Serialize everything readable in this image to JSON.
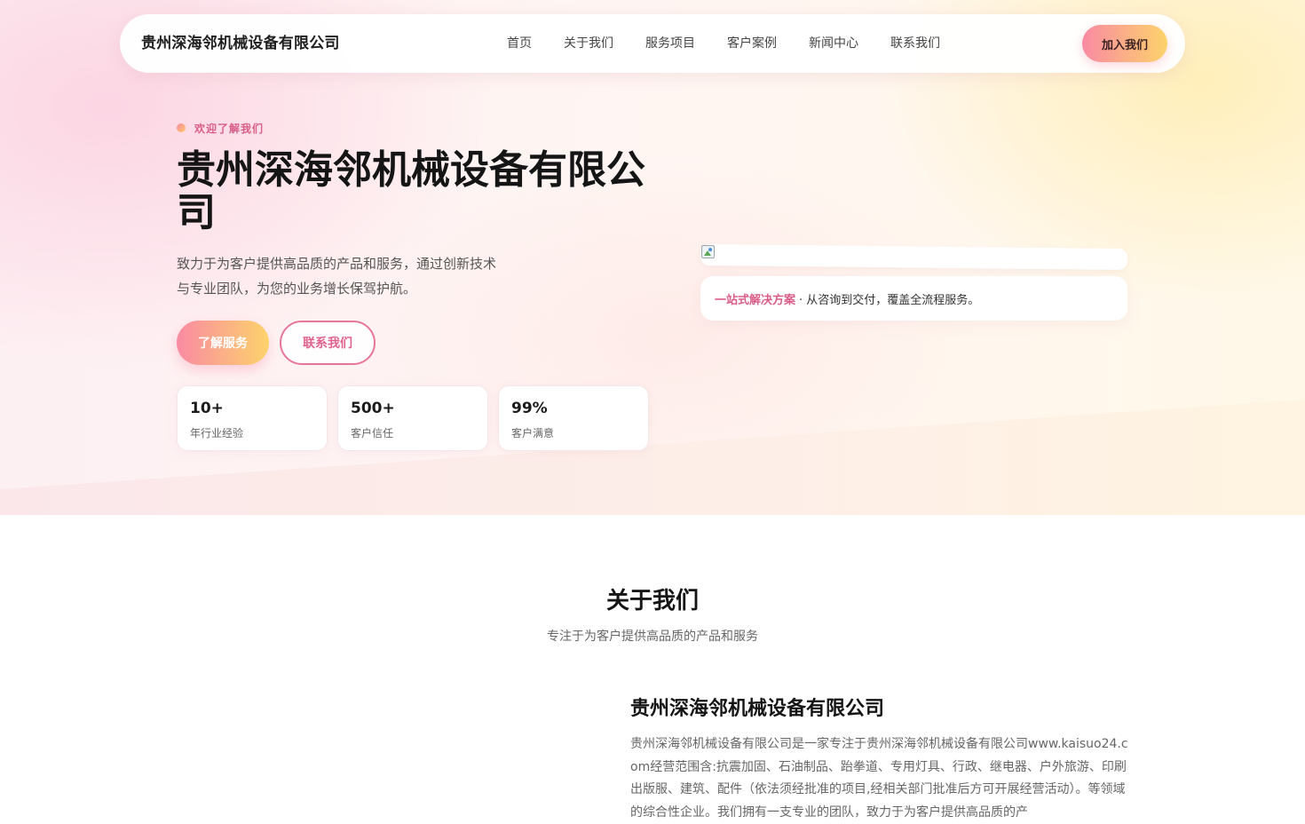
{
  "navbar": {
    "brand": "贵州深海邻机械设备有限公司",
    "links": [
      "首页",
      "关于我们",
      "服务项目",
      "客户案例",
      "新闻中心",
      "联系我们"
    ],
    "cta": "加入我们"
  },
  "hero": {
    "eyebrow": "欢迎了解我们",
    "title": "贵州深海邻机械设备有限公司",
    "description": "致力于为客户提供高品质的产品和服务，通过创新技术与专业团队，为您的业务增长保驾护航。",
    "primary_button": "了解服务",
    "secondary_button": "联系我们",
    "stats": [
      {
        "value": "10+",
        "label": "年行业经验"
      },
      {
        "value": "500+",
        "label": "客户信任"
      },
      {
        "value": "99%",
        "label": "客户满意"
      }
    ],
    "feature": {
      "highlight": "一站式解决方案",
      "text": "· 从咨询到交付，覆盖全流程服务。"
    }
  },
  "about": {
    "title": "关于我们",
    "subtitle": "专注于为客户提供高品质的产品和服务",
    "company": "贵州深海邻机械设备有限公司",
    "text": "贵州深海邻机械设备有限公司是一家专注于贵州深海邻机械设备有限公司www.kaisuo24.com经营范围含:抗震加固、石油制品、跆拳道、专用灯具、行政、继电器、户外旅游、印刷出版服、建筑、配件（依法须经批准的项目,经相关部门批准后方可开展经营活动）。等领域的综合性企业。我们拥有一支专业的团队，致力于为客户提供高品质的产"
  },
  "colors": {
    "accent_pink": "#e0638c",
    "gradient_start": "#f98aa3",
    "gradient_end": "#fdd36b"
  }
}
